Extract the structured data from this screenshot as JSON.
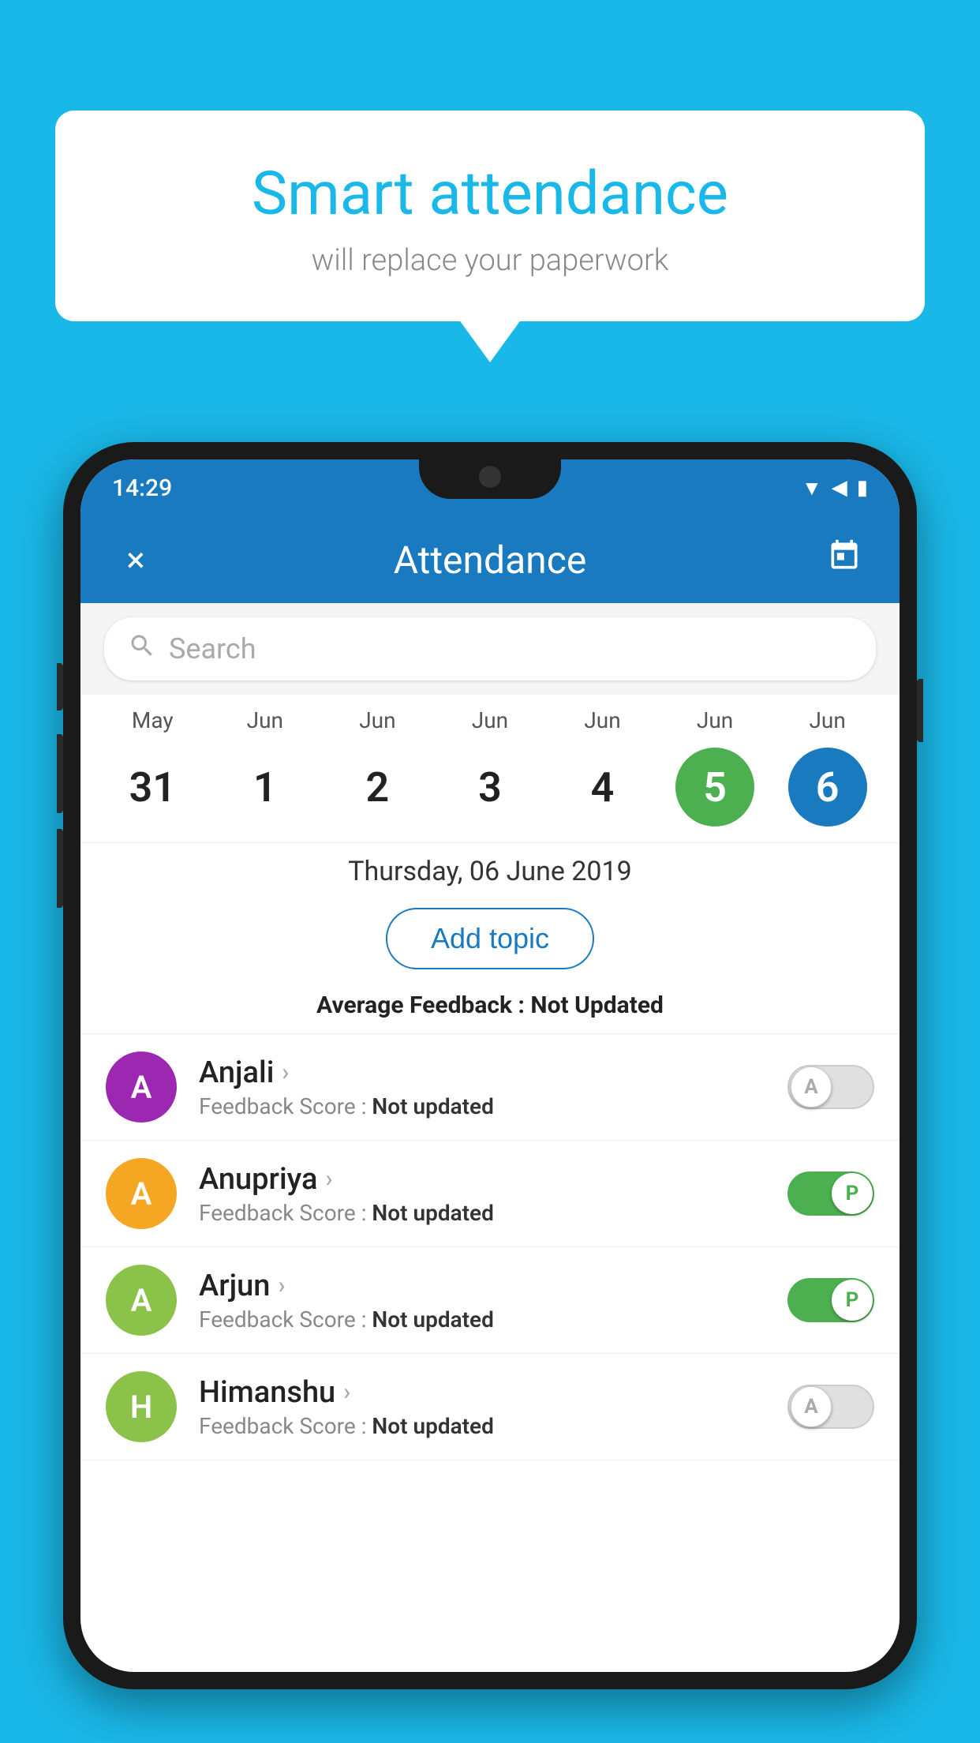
{
  "background_color": "#1ab8e8",
  "speech_bubble": {
    "title": "Smart attendance",
    "subtitle": "will replace your paperwork"
  },
  "status_bar": {
    "time": "14:29",
    "icons": [
      "wifi",
      "signal",
      "battery"
    ]
  },
  "app_bar": {
    "title": "Attendance",
    "close_label": "×",
    "calendar_label": "📅"
  },
  "search": {
    "placeholder": "Search"
  },
  "calendar": {
    "days": [
      {
        "month": "May",
        "date": "31",
        "selected": ""
      },
      {
        "month": "Jun",
        "date": "1",
        "selected": ""
      },
      {
        "month": "Jun",
        "date": "2",
        "selected": ""
      },
      {
        "month": "Jun",
        "date": "3",
        "selected": ""
      },
      {
        "month": "Jun",
        "date": "4",
        "selected": ""
      },
      {
        "month": "Jun",
        "date": "5",
        "selected": "green"
      },
      {
        "month": "Jun",
        "date": "6",
        "selected": "blue"
      }
    ],
    "selected_date_label": "Thursday, 06 June 2019"
  },
  "add_topic_label": "Add topic",
  "avg_feedback": {
    "label": "Average Feedback : ",
    "value": "Not Updated"
  },
  "students": [
    {
      "name": "Anjali",
      "initial": "A",
      "avatar_color": "#9c27b0",
      "feedback_label": "Feedback Score : ",
      "feedback_value": "Not updated",
      "toggle": "off",
      "toggle_letter": "A"
    },
    {
      "name": "Anupriya",
      "initial": "A",
      "avatar_color": "#f5a623",
      "feedback_label": "Feedback Score : ",
      "feedback_value": "Not updated",
      "toggle": "on",
      "toggle_letter": "P"
    },
    {
      "name": "Arjun",
      "initial": "A",
      "avatar_color": "#8bc34a",
      "feedback_label": "Feedback Score : ",
      "feedback_value": "Not updated",
      "toggle": "on",
      "toggle_letter": "P"
    },
    {
      "name": "Himanshu",
      "initial": "H",
      "avatar_color": "#8bc34a",
      "feedback_label": "Feedback Score : ",
      "feedback_value": "Not updated",
      "toggle": "off",
      "toggle_letter": "A"
    }
  ]
}
